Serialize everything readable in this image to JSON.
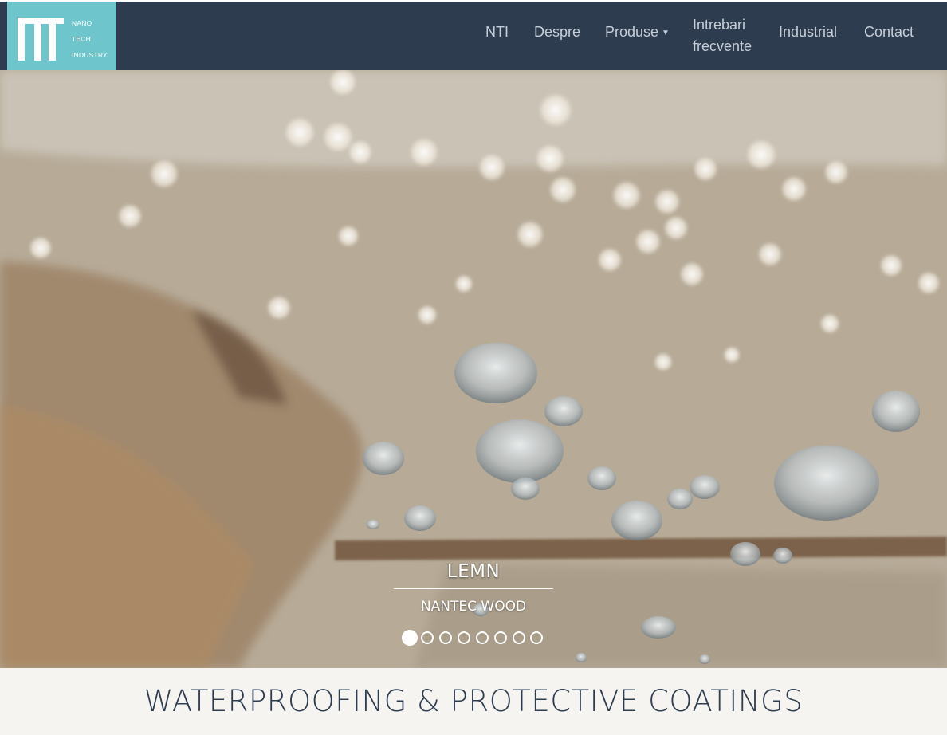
{
  "logo": {
    "words": [
      "NANO",
      "TECH",
      "INDUSTRY"
    ],
    "background": "#6ec6cc"
  },
  "nav": {
    "background": "#2e3c4f",
    "items": [
      {
        "label": "NTI"
      },
      {
        "label": "Despre"
      },
      {
        "label": "Produse",
        "dropdown": true,
        "icon": "caret-down-icon"
      },
      {
        "label_lines": [
          "Intrebari",
          "frecvente"
        ]
      },
      {
        "label": "Industrial"
      },
      {
        "label": "Contact"
      }
    ]
  },
  "carousel": {
    "title": "LEMN",
    "subtitle": "NANTEC WOOD",
    "slide_count": 8,
    "active_slide": 1
  },
  "tagline": "WATERPROOFING & PROTECTIVE COATINGS"
}
